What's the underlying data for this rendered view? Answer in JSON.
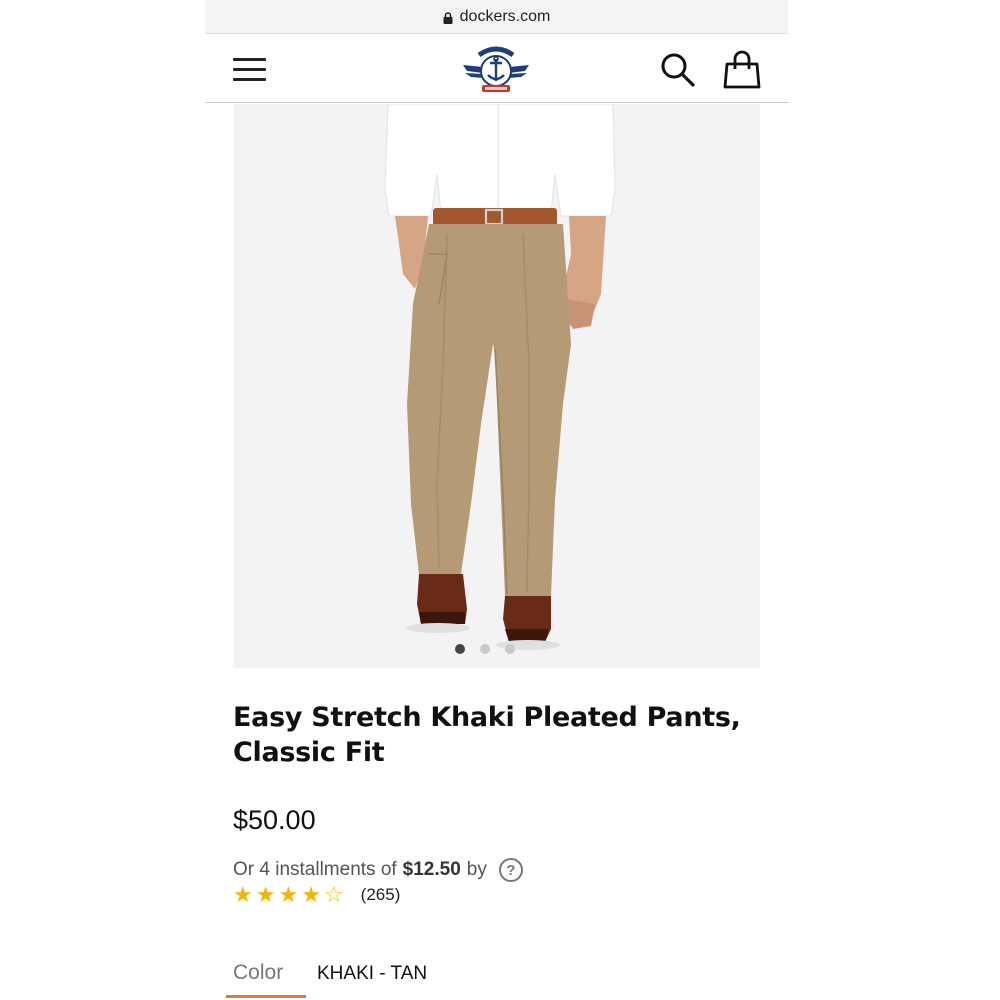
{
  "browser": {
    "url": "dockers.com"
  },
  "header": {
    "menu_icon": "hamburger-menu-icon",
    "logo_icon": "dockers-anchor-logo",
    "search_icon": "search-icon",
    "bag_icon": "shopping-bag-icon"
  },
  "gallery": {
    "image_count": 3,
    "active_index": 0
  },
  "product": {
    "title_line1": "Easy Stretch Khaki Pleated Pants,",
    "title_line2": "Classic Fit",
    "price": "$50.00",
    "installments_prefix": "Or 4 installments of",
    "installment_amount": "$12.50",
    "installments_suffix": "by",
    "help_symbol": "?",
    "rating": 4,
    "rating_max": 5,
    "review_count": "(265)"
  },
  "color": {
    "label": "Color",
    "value": "KHAKI - TAN"
  },
  "colors": {
    "accent": "#e07b3c",
    "star": "#f2b705",
    "khaki": "#b59a76"
  }
}
